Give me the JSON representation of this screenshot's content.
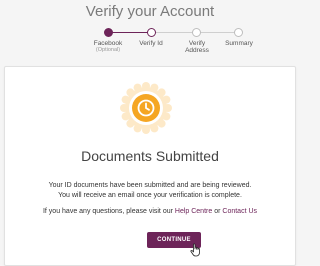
{
  "page": {
    "title": "Verify your Account"
  },
  "steps": [
    {
      "label": "Facebook",
      "sublabel": "(Optional)",
      "state": "done"
    },
    {
      "label": "Verify Id",
      "state": "current"
    },
    {
      "label": "Verify Address",
      "state": "pending"
    },
    {
      "label": "Summary",
      "state": "pending"
    }
  ],
  "card": {
    "icon": "clock-icon",
    "heading": "Documents Submitted",
    "line1": "Your ID documents have been submitted and are being reviewed.",
    "line2": "You will receive an email once your verification is complete.",
    "help_prefix": "If you have any questions, please visit our",
    "help_link": "Help Centre",
    "help_or": "or",
    "contact_link": "Contact Us",
    "button_label": "CONTINUE"
  },
  "colors": {
    "accent": "#6d2459",
    "badge_orange": "#f5a623",
    "badge_ring": "#fde9c8"
  }
}
